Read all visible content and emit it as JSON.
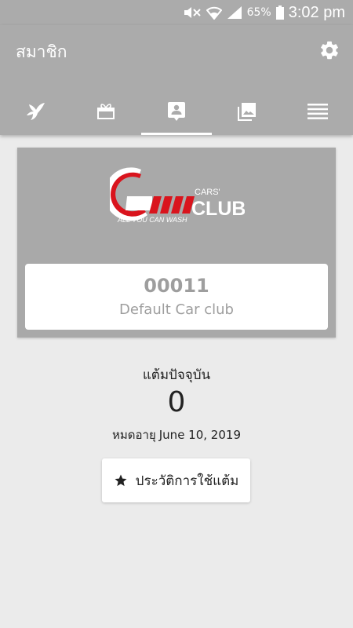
{
  "status": {
    "battery": "65%",
    "time": "3:02 pm"
  },
  "appbar": {
    "title": "สมาชิก"
  },
  "tabs": [
    {
      "icon": "bird-icon"
    },
    {
      "icon": "gift-card-icon"
    },
    {
      "icon": "member-card-icon",
      "active": true
    },
    {
      "icon": "gallery-icon"
    },
    {
      "icon": "menu-icon"
    }
  ],
  "card": {
    "logo_text": "CARS'",
    "logo_club": "CLUB",
    "logo_tagline": "ALL YOU CAN WASH",
    "member_id": "00011",
    "club_name": "Default Car club"
  },
  "points": {
    "label": "แต้มปัจจุบัน",
    "value": "0"
  },
  "expiry": {
    "label": "หมดอายุ",
    "date": "June 10, 2019"
  },
  "history_button": {
    "label": "ประวัติการใช้แต้ม"
  },
  "colors": {
    "primary": "#ababab",
    "background": "#ebebeb",
    "muted_text": "#9e9e9e",
    "logo_red": "#d9141d"
  }
}
